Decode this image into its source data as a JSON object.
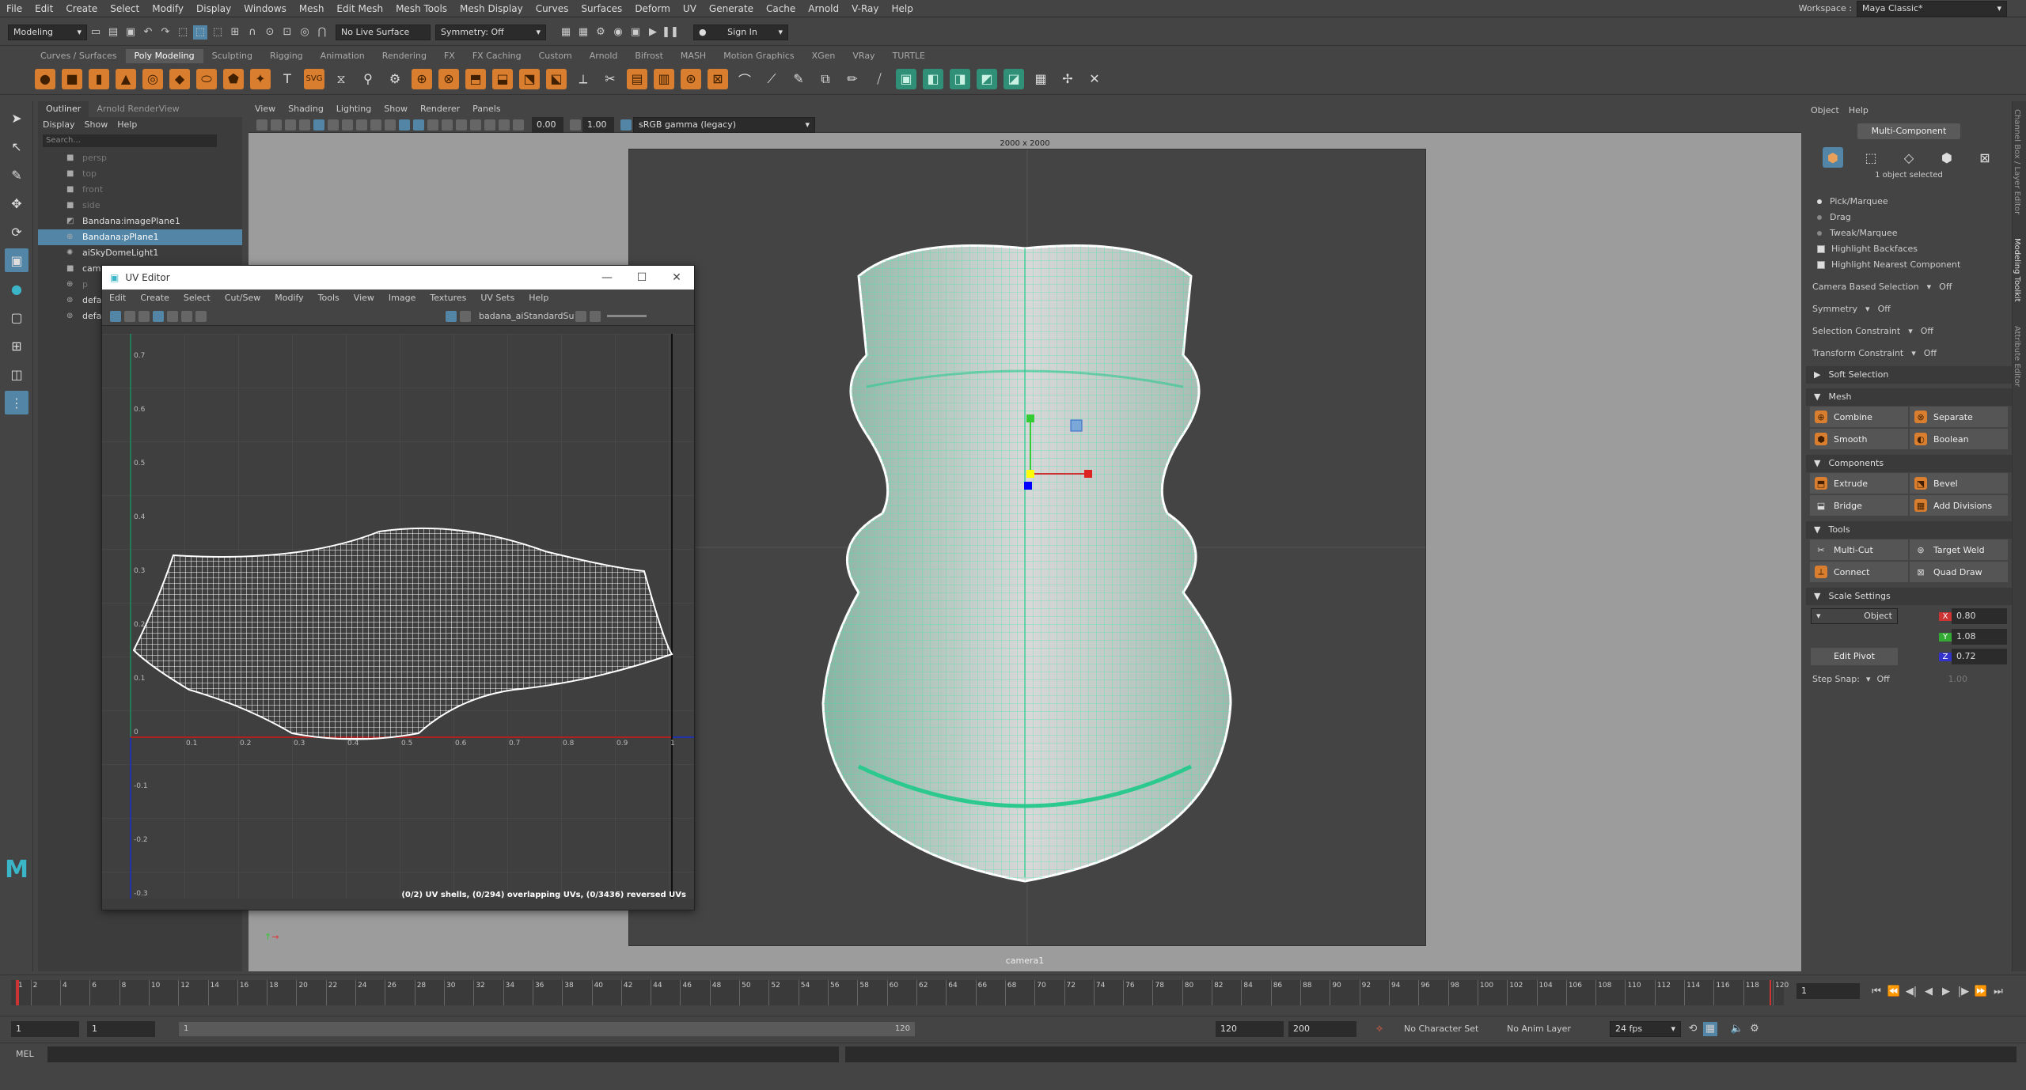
{
  "menubar": {
    "items": [
      "File",
      "Edit",
      "Create",
      "Select",
      "Modify",
      "Display",
      "Windows",
      "Mesh",
      "Edit Mesh",
      "Mesh Tools",
      "Mesh Display",
      "Curves",
      "Surfaces",
      "Deform",
      "UV",
      "Generate",
      "Cache",
      "Arnold",
      "V-Ray",
      "Help"
    ],
    "workspace_label": "Workspace :",
    "workspace_value": "Maya Classic*"
  },
  "statusline": {
    "mode": "Modeling",
    "live_surface": "No Live Surface",
    "symmetry": "Symmetry: Off",
    "sign_in": "Sign In"
  },
  "shelf": {
    "tabs": [
      "Curves / Surfaces",
      "Poly Modeling",
      "Sculpting",
      "Rigging",
      "Animation",
      "Rendering",
      "FX",
      "FX Caching",
      "Custom",
      "Arnold",
      "Bifrost",
      "MASH",
      "Motion Graphics",
      "XGen",
      "VRay",
      "TURTLE"
    ],
    "active": "Poly Modeling"
  },
  "outliner": {
    "tabs": [
      "Outliner",
      "Arnold RenderView"
    ],
    "menu": [
      "Display",
      "Show",
      "Help"
    ],
    "search_placeholder": "Search...",
    "items": [
      {
        "label": "persp",
        "dim": true
      },
      {
        "label": "top",
        "dim": true
      },
      {
        "label": "front",
        "dim": true
      },
      {
        "label": "side",
        "dim": true
      },
      {
        "label": "Bandana:imagePlane1",
        "dim": false
      },
      {
        "label": "Bandana:pPlane1",
        "dim": false,
        "selected": true
      },
      {
        "label": "aiSkyDomeLight1",
        "dim": false
      },
      {
        "label": "came",
        "dim": false
      },
      {
        "label": "p",
        "dim": true
      },
      {
        "label": "defa",
        "dim": false
      },
      {
        "label": "defa",
        "dim": false
      }
    ]
  },
  "viewport": {
    "menu": [
      "View",
      "Shading",
      "Lighting",
      "Show",
      "Renderer",
      "Panels"
    ],
    "field1": "0.00",
    "field2": "1.00",
    "colorspace": "sRGB gamma (legacy)",
    "resolution": "2000 x 2000",
    "camera": "camera1"
  },
  "uv_editor": {
    "title": "UV Editor",
    "menu": [
      "Edit",
      "Create",
      "Select",
      "Cut/Sew",
      "Modify",
      "Tools",
      "View",
      "Image",
      "Textures",
      "UV Sets",
      "Help"
    ],
    "shader": "badana_aiStandardSu",
    "status": "(0/2) UV shells, (0/294) overlapping UVs, (0/3436) reversed UVs",
    "y_ticks": [
      "0.7",
      "0.6",
      "0.5",
      "0.4",
      "0.3",
      "0.2",
      "0.1",
      "0",
      "-0.1",
      "-0.2",
      "-0.3"
    ],
    "x_ticks": [
      "0.1",
      "0.2",
      "0.3",
      "0.4",
      "0.5",
      "0.6",
      "0.7",
      "0.8",
      "0.9",
      "1"
    ]
  },
  "attr": {
    "menu": [
      "Object",
      "Help"
    ],
    "mode": "Multi-Component",
    "selected": "1 object selected",
    "pick_options": [
      "Pick/Marquee",
      "Drag",
      "Tweak/Marquee"
    ],
    "checks": [
      "Highlight Backfaces",
      "Highlight Nearest Component"
    ],
    "camera_based": "Camera Based Selection",
    "camera_based_val": "Off",
    "symmetry": "Symmetry",
    "symmetry_val": "Off",
    "sel_constraint": "Selection Constraint",
    "sel_constraint_val": "Off",
    "xf_constraint": "Transform Constraint",
    "xf_constraint_val": "Off",
    "soft_sel": "Soft Selection",
    "mesh_label": "Mesh",
    "mesh_btns": [
      "Combine",
      "Separate",
      "Smooth",
      "Boolean"
    ],
    "comp_label": "Components",
    "comp_btns": [
      "Extrude",
      "Bevel",
      "Bridge",
      "Add Divisions"
    ],
    "tools_label": "Tools",
    "tools_btns": [
      "Multi-Cut",
      "Target Weld",
      "Connect",
      "Quad Draw"
    ],
    "scale_label": "Scale Settings",
    "scale_space": "Object",
    "x": "0.80",
    "y": "1.08",
    "z": "0.72",
    "edit_pivot": "Edit Pivot",
    "step_snap": "Step Snap:",
    "step_snap_val": "Off",
    "step_snap_num": "1.00",
    "side_tabs": [
      "Channel Box / Layer Editor",
      "Modeling Toolkit",
      "Attribute Editor"
    ]
  },
  "timeline": {
    "ticks": [
      "1",
      "2",
      "4",
      "6",
      "8",
      "10",
      "12",
      "14",
      "16",
      "18",
      "20",
      "22",
      "24",
      "26",
      "28",
      "30",
      "32",
      "34",
      "36",
      "38",
      "40",
      "42",
      "44",
      "46",
      "48",
      "50",
      "52",
      "54",
      "56",
      "58",
      "60",
      "62",
      "64",
      "66",
      "68",
      "70",
      "72",
      "74",
      "76",
      "78",
      "80",
      "82",
      "84",
      "86",
      "88",
      "90",
      "92",
      "94",
      "96",
      "98",
      "100",
      "102",
      "104",
      "106",
      "108",
      "110",
      "112",
      "114",
      "116",
      "118",
      "120"
    ],
    "current_frame": "1"
  },
  "range": {
    "start": "1",
    "start2": "1",
    "slider_start": "1",
    "slider_end": "120",
    "end": "120",
    "end2": "200",
    "char_set": "No Character Set",
    "anim_layer": "No Anim Layer",
    "fps": "24 fps"
  },
  "cmd": {
    "label": "MEL"
  },
  "colors": {
    "accent": "#5285a6",
    "shelf_orange": "#d97e2e",
    "mesh_wire": "#3be8a6"
  }
}
